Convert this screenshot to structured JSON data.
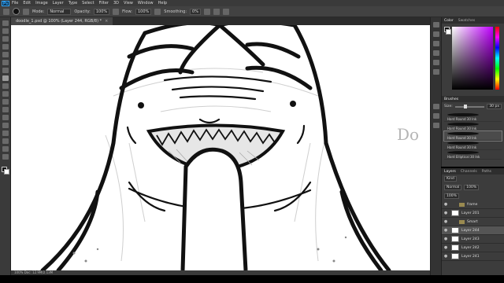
{
  "app": {
    "logo": "Ps",
    "menu": [
      "File",
      "Edit",
      "Image",
      "Layer",
      "Type",
      "Select",
      "Filter",
      "3D",
      "View",
      "Window",
      "Help"
    ]
  },
  "options": {
    "mode_label": "Mode:",
    "mode_value": "Normal",
    "opacity_label": "Opacity:",
    "opacity_value": "100%",
    "flow_label": "Flow:",
    "flow_value": "100%",
    "smoothing_label": "Smoothing:",
    "smoothing_value": "0%"
  },
  "document": {
    "tab_title": "doodle_1.psd @ 100% (Layer 244, RGB/8) *",
    "close_glyph": "×",
    "status_text": "100%    Doc: 12.9M/2.13M",
    "canvas_text": "Do"
  },
  "panels": {
    "color_tabs": [
      "Color",
      "Swatches"
    ],
    "brushes_title": "Brushes",
    "size_label": "Size:",
    "size_value": "30 px",
    "brushes": [
      {
        "name": "Hard Round 30 Ink"
      },
      {
        "name": "Hard Round 30 Ink"
      },
      {
        "name": "Hard Round 30 Ink"
      },
      {
        "name": "Hard Round 30 Ink"
      },
      {
        "name": "Hard Elliptical 30 Ink"
      }
    ],
    "layer_tabs": [
      "Layers",
      "Channels",
      "Paths"
    ],
    "kind_label": "Kind",
    "blend_value": "Normal",
    "opacity_short": "100%",
    "fill_short": "100%",
    "eye_glyph": "●",
    "layers": [
      {
        "name": "frame",
        "type": "folder",
        "visible": true
      },
      {
        "name": "Layer 201",
        "type": "layer",
        "visible": true
      },
      {
        "name": "Smart",
        "type": "folder",
        "visible": true
      },
      {
        "name": "Layer 244",
        "type": "layer",
        "visible": true,
        "selected": true
      },
      {
        "name": "Layer 243",
        "type": "layer",
        "visible": true
      },
      {
        "name": "Layer 242",
        "type": "layer",
        "visible": true
      },
      {
        "name": "Layer 241",
        "type": "layer",
        "visible": true
      }
    ]
  },
  "colors": {
    "foreground": "#111111",
    "background": "#ffffff",
    "ink": "#111111",
    "ui_dark": "#3a3a3a"
  }
}
